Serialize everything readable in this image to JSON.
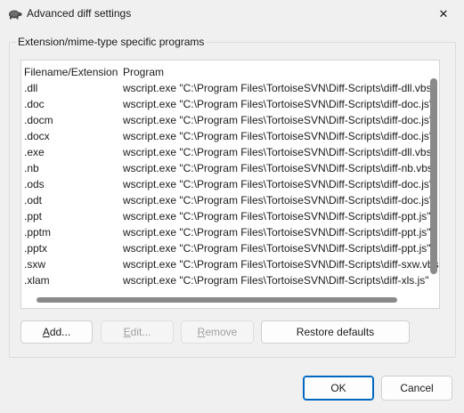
{
  "window": {
    "title": "Advanced diff settings",
    "close_glyph": "✕"
  },
  "group": {
    "label": "Extension/mime-type specific programs"
  },
  "list": {
    "columns": [
      "Filename/Extension",
      "Program"
    ],
    "rows": [
      {
        "ext": ".dll",
        "program": "wscript.exe \"C:\\Program Files\\TortoiseSVN\\Diff-Scripts\\diff-dll.vbs\""
      },
      {
        "ext": ".doc",
        "program": "wscript.exe \"C:\\Program Files\\TortoiseSVN\\Diff-Scripts\\diff-doc.js\""
      },
      {
        "ext": ".docm",
        "program": "wscript.exe \"C:\\Program Files\\TortoiseSVN\\Diff-Scripts\\diff-doc.js\""
      },
      {
        "ext": ".docx",
        "program": "wscript.exe \"C:\\Program Files\\TortoiseSVN\\Diff-Scripts\\diff-doc.js\""
      },
      {
        "ext": ".exe",
        "program": "wscript.exe \"C:\\Program Files\\TortoiseSVN\\Diff-Scripts\\diff-dll.vbs\""
      },
      {
        "ext": ".nb",
        "program": "wscript.exe \"C:\\Program Files\\TortoiseSVN\\Diff-Scripts\\diff-nb.vbs\""
      },
      {
        "ext": ".ods",
        "program": "wscript.exe \"C:\\Program Files\\TortoiseSVN\\Diff-Scripts\\diff-doc.js\""
      },
      {
        "ext": ".odt",
        "program": "wscript.exe \"C:\\Program Files\\TortoiseSVN\\Diff-Scripts\\diff-doc.js\""
      },
      {
        "ext": ".ppt",
        "program": "wscript.exe \"C:\\Program Files\\TortoiseSVN\\Diff-Scripts\\diff-ppt.js\""
      },
      {
        "ext": ".pptm",
        "program": "wscript.exe \"C:\\Program Files\\TortoiseSVN\\Diff-Scripts\\diff-ppt.js\""
      },
      {
        "ext": ".pptx",
        "program": "wscript.exe \"C:\\Program Files\\TortoiseSVN\\Diff-Scripts\\diff-ppt.js\""
      },
      {
        "ext": ".sxw",
        "program": "wscript.exe \"C:\\Program Files\\TortoiseSVN\\Diff-Scripts\\diff-sxw.vbs\""
      },
      {
        "ext": ".xlam",
        "program": "wscript.exe \"C:\\Program Files\\TortoiseSVN\\Diff-Scripts\\diff-xls.js\""
      }
    ]
  },
  "buttons": {
    "add": {
      "first": "A",
      "rest": "dd..."
    },
    "edit": {
      "first": "E",
      "rest": "dit..."
    },
    "remove": {
      "first": "R",
      "rest": "emove"
    },
    "restore": {
      "label": "Restore defaults"
    },
    "ok": {
      "label": "OK"
    },
    "cancel": {
      "label": "Cancel"
    }
  },
  "colors": {
    "accent": "#0067c0",
    "scrollbar": "#8a8a8a",
    "disabled_text": "#a0a0a0"
  },
  "icons": {
    "app": "tortoise-icon",
    "close": "close-icon"
  }
}
